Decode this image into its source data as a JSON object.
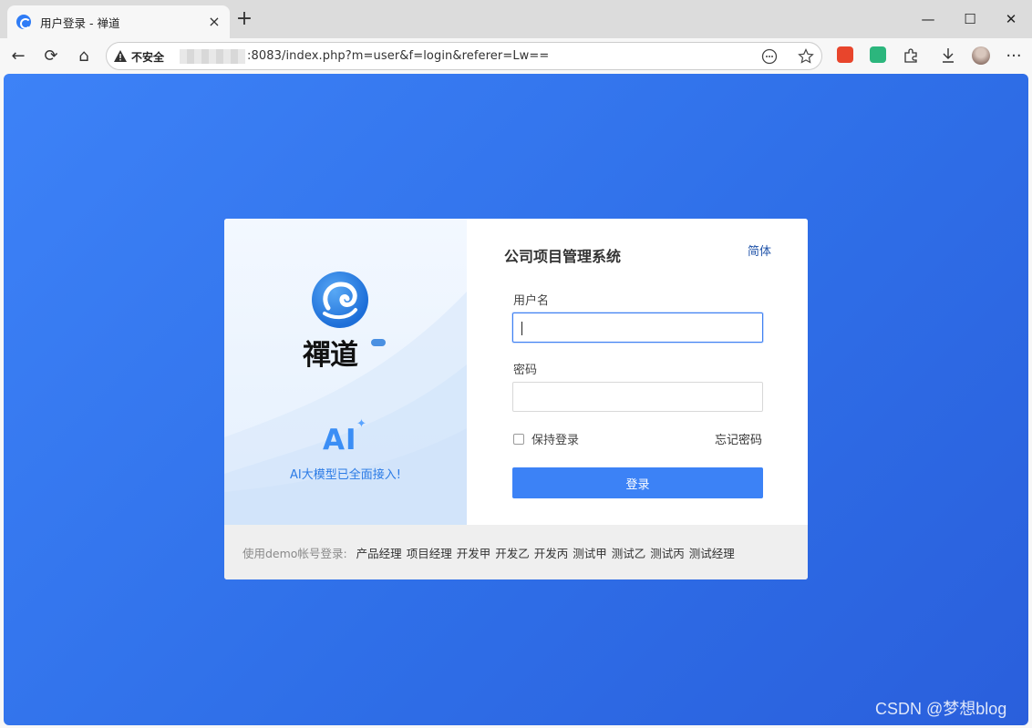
{
  "browser": {
    "tab_title": "用户登录 - 禅道",
    "tab_close": "×",
    "new_tab": "+",
    "window_controls": {
      "minimize": "—",
      "maximize": "☐",
      "close": "✕"
    },
    "nav": {
      "back": "←",
      "reload": "⟳",
      "home": "⌂"
    },
    "address": {
      "security_label": "不安全",
      "url": ":8083/index.php?m=user&f=login&referer=Lw=="
    },
    "more": "···"
  },
  "login": {
    "system_title": "公司项目管理系统",
    "language": "简体",
    "username_label": "用户名",
    "username_value": "",
    "password_label": "密码",
    "password_value": "",
    "remember_label": "保持登录",
    "forgot_label": "忘记密码",
    "submit_label": "登录"
  },
  "branding": {
    "logo_text": "禪道",
    "ai_mark": "AI",
    "ai_slogan": "AI大模型已全面接入!"
  },
  "demo": {
    "label": "使用demo帐号登录:",
    "accounts": [
      "产品经理",
      "项目经理",
      "开发甲",
      "开发乙",
      "开发丙",
      "测试甲",
      "测试乙",
      "测试丙",
      "测试经理"
    ]
  },
  "watermark": "CSDN @梦想blog",
  "colors": {
    "page_bg": "#2f6fe8",
    "button": "#3c82f6",
    "link": "#2255aa",
    "ai_text": "#2b7be6"
  }
}
